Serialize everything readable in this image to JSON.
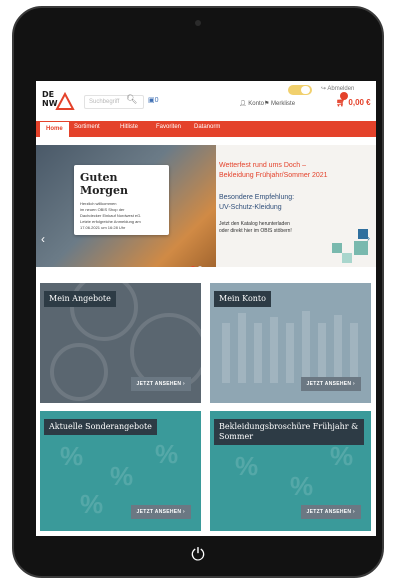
{
  "header": {
    "logo_top": "DE",
    "logo_bottom": "NW",
    "search_placeholder": "Suchbegriff",
    "search_icon": "search-icon",
    "compare_label": "0",
    "logout_label": "Abmelden",
    "konto_label": "Konto",
    "merkliste_label": "Merkliste",
    "cart_total": "0,00 €"
  },
  "nav": {
    "items": [
      "Home",
      "Sortiment",
      "Hitliste",
      "Favoriten",
      "Datanorm"
    ],
    "active": "Home"
  },
  "hero": {
    "title": "Guten Morgen",
    "lines": [
      "Herzlich willkommen",
      "im neuen OBIS Shop der",
      "Dachdecker Einkauf Nordwest eG.",
      "Letzte erfolgreiche Anmeldung am",
      "17.06.2021 um 16:28 Uhr"
    ],
    "red_line1": "Wetterfest rund ums Doch –",
    "red_line2": "Bekleidung Frühjahr/Sommer 2021",
    "blue_line1": "Besondere Empfehlung:",
    "blue_line2": "UV-Schutz-Kleidung",
    "cta_line1": "Jetzt den Katalog herunterladen",
    "cta_line2": "oder direkt hier im OBIS stöbern!",
    "prev_icon": "chevron-left-icon",
    "next_icon": "chevron-right-icon"
  },
  "tiles": [
    {
      "label": "Mein Angebote",
      "button": "JETZT ANSEHEN  ›",
      "color": "#5a6670"
    },
    {
      "label": "Mein Konto",
      "button": "JETZT ANSEHEN  ›",
      "color": "#8fa6b3"
    },
    {
      "label": "Aktuelle Sonderangebote",
      "button": "JETZT ANSEHEN  ›",
      "color": "#3a9a9a"
    },
    {
      "label": "Bekleidungsbroschüre Frühjahr & Sommer",
      "button": "JETZT ANSEHEN  ›",
      "color": "#3a9a9a"
    }
  ],
  "colors": {
    "accent": "#e4422b",
    "dark": "#2d3b45"
  },
  "device": {
    "home_icon": "power-icon"
  }
}
